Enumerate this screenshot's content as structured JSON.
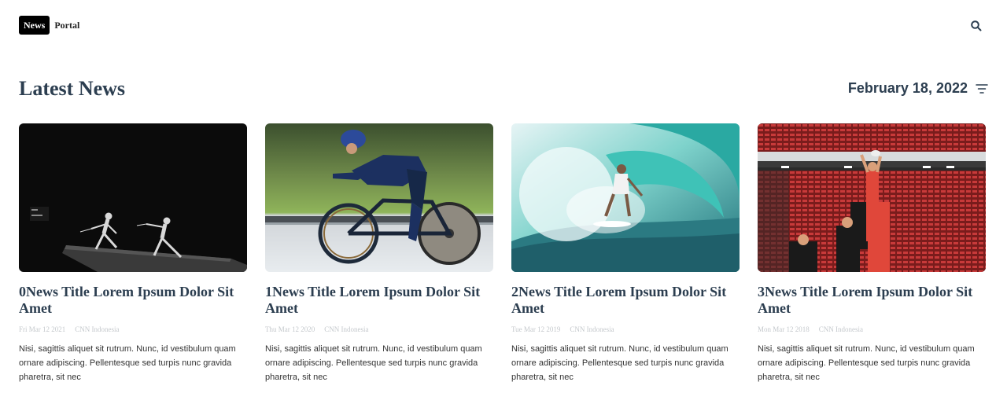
{
  "brand": {
    "badge": "News",
    "name": "Portal"
  },
  "header": {
    "search_icon": "search-icon"
  },
  "section": {
    "title": "Latest News",
    "date": "February 18, 2022",
    "filter_icon": "filter-icon"
  },
  "articles": [
    {
      "title": "0News Title Lorem Ipsum Dolor Sit Amet",
      "date": "Fri Mar 12 2021",
      "source": "CNN Indonesia",
      "excerpt": "Nisi, sagittis aliquet sit rutrum. Nunc, id vestibulum quam ornare adipiscing. Pellentesque sed turpis nunc gravida pharetra, sit nec"
    },
    {
      "title": "1News Title Lorem Ipsum Dolor Sit Amet",
      "date": "Thu Mar 12 2020",
      "source": "CNN Indonesia",
      "excerpt": "Nisi, sagittis aliquet sit rutrum. Nunc, id vestibulum quam ornare adipiscing. Pellentesque sed turpis nunc gravida pharetra, sit nec"
    },
    {
      "title": "2News Title Lorem Ipsum Dolor Sit Amet",
      "date": "Tue Mar 12 2019",
      "source": "CNN Indonesia",
      "excerpt": "Nisi, sagittis aliquet sit rutrum. Nunc, id vestibulum quam ornare adipiscing. Pellentesque sed turpis nunc gravida pharetra, sit nec"
    },
    {
      "title": "3News Title Lorem Ipsum Dolor Sit Amet",
      "date": "Mon Mar 12 2018",
      "source": "CNN Indonesia",
      "excerpt": "Nisi, sagittis aliquet sit rutrum. Nunc, id vestibulum quam ornare adipiscing. Pellentesque sed turpis nunc gravida pharetra, sit nec"
    }
  ],
  "colors": {
    "heading": "#2c3e50",
    "meta": "#c4c8cc",
    "body": "#333333"
  }
}
